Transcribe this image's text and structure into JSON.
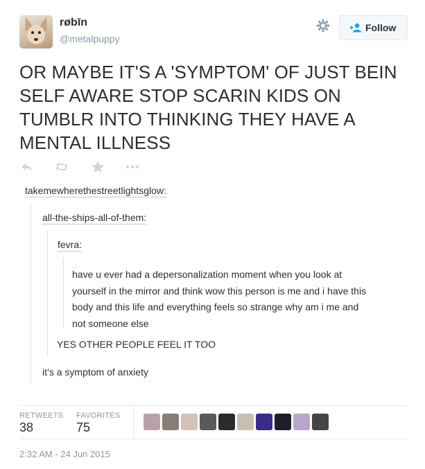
{
  "user": {
    "name": "røbīn",
    "handle": "@metalpuppy"
  },
  "follow_label": "Follow",
  "tweet": {
    "text": "OR MAYBE IT'S A 'SYMPTOM' OF JUST BEIN SELF AWARE STOP SCARIN KIDS ON TUMBLR INTO THINKING THEY HAVE A MENTAL ILLNESS"
  },
  "action_icons": [
    "reply-icon",
    "retweet-icon",
    "favorite-icon",
    "more-icon"
  ],
  "image_post": {
    "level1_user": "takemewherethestreetlightsglow:",
    "level2_user": "all-the-ships-all-of-them:",
    "level3_user": "fevra:",
    "level3_lines": [
      "have u ever had a depersonalization moment when you look at",
      "yourself in the mirror and think wow this person is me and i have this",
      "body and this life and everything feels so strange why am i me and",
      "not someone else"
    ],
    "level2_reply": "YES OTHER PEOPLE FEEL IT TOO",
    "level1_reply": "it’s a symptom of anxiety"
  },
  "stats": {
    "retweets_label": "RETWEETS",
    "retweets": "38",
    "favorites_label": "FAVORITES",
    "favorites": "75"
  },
  "favoriter_avatar_colors": [
    "#b9a3a8",
    "#8a7e74",
    "#d2c1b4",
    "#5a5a5a",
    "#2b2b2b",
    "#c9bfb0",
    "#3b2a8a",
    "#1d1d2a",
    "#b7a6c9",
    "#444444"
  ],
  "timestamp": "2:32 AM - 24 Jun 2015",
  "colors": {
    "text": "#292f33",
    "muted": "#8899a6",
    "follow_accent": "#1da1f2",
    "icon_grey": "#ccd6dd"
  }
}
